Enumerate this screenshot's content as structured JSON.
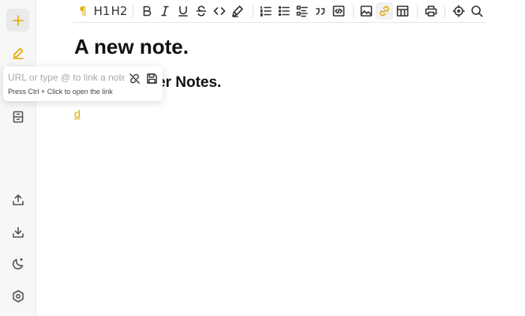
{
  "theme": {
    "accent": "#e0a800",
    "sidebar_bg": "#f7f7f7"
  },
  "sidebar": {
    "items": [
      {
        "icon": "plus-icon",
        "label": "New note"
      },
      {
        "icon": "pencil-icon",
        "label": "Edit"
      },
      {
        "icon": "archive-icon",
        "label": "Archive"
      },
      {
        "icon": "upload-icon",
        "label": "Export"
      },
      {
        "icon": "download-icon",
        "label": "Import"
      },
      {
        "icon": "moon-icon",
        "label": "Theme"
      },
      {
        "icon": "settings-icon",
        "label": "Settings"
      }
    ]
  },
  "toolbar": {
    "paragraph": "¶",
    "h1": "H1",
    "h2": "H2",
    "buttons": [
      "paragraph",
      "heading-1",
      "heading-2",
      "bold",
      "italic",
      "underline",
      "strikethrough",
      "code",
      "highlight",
      "ordered-list",
      "bullet-list",
      "task-list",
      "blockquote",
      "code-block",
      "image",
      "link",
      "table",
      "print",
      "focus",
      "search"
    ],
    "active": "link"
  },
  "editor": {
    "title": "A new note.",
    "subtitle_visible": "er Notes.",
    "link_text": "d"
  },
  "link_popover": {
    "placeholder": "URL or type @ to link a note",
    "value": "",
    "hint": "Press Ctrl + Click to open the link"
  }
}
